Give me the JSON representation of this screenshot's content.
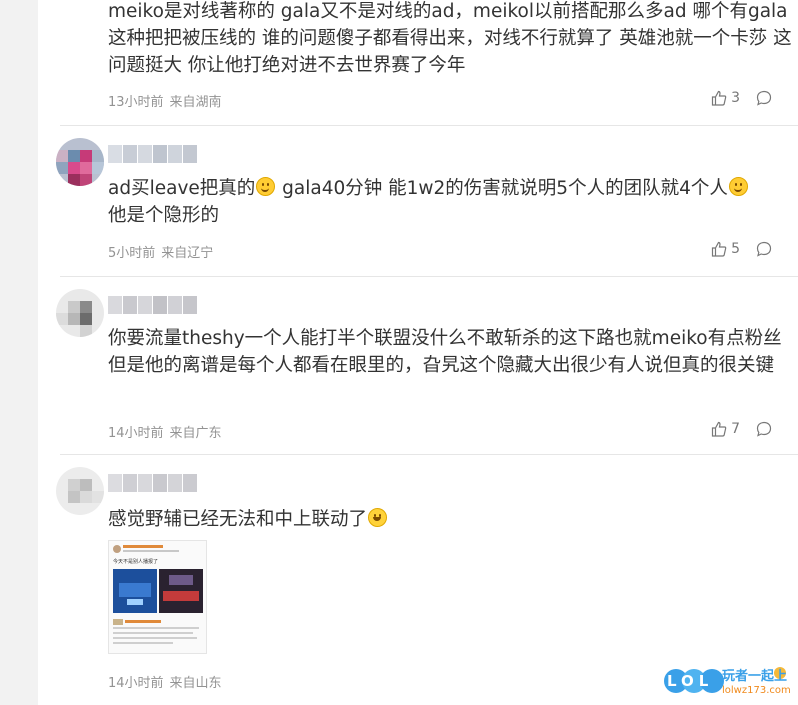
{
  "comments": [
    {
      "text": "meiko是对线著称的 gala又不是对线的ad，meikol以前搭配那么多ad 哪个有gala这种把把被压线的 谁的问题傻子都看得出来，对线不行就算了 英雄池就一个卡莎 这问题挺大 你让他打绝对进不去世界赛了今年",
      "time": "13小时前",
      "location": "来自湖南",
      "likes": "3"
    },
    {
      "text_parts": [
        "ad买leave把真的",
        " gala40分钟 能1w2的伤害就说明5个人的团队就4个人",
        "他是个隐形的"
      ],
      "time": "5小时前",
      "location": "来自辽宁",
      "likes": "5"
    },
    {
      "text": "你要流量theshy一个人能打半个联盟没什么不敢斩杀的这下路也就meiko有点粉丝但是他的离谱是每个人都看在眼里的，旮旯这个隐藏大出很少有人说但真的很关键",
      "time": "14小时前",
      "location": "来自广东",
      "likes": "7"
    },
    {
      "text": "感觉野辅已经无法和中上联动了",
      "time": "14小时前",
      "location": "来自山东",
      "image_caption": "今天不是别人播报了"
    }
  ],
  "watermark": {
    "brand": "LOL",
    "slogan": "玩者一起上",
    "site": "lolwz173.com"
  },
  "colors": {
    "text": "#333333",
    "meta": "#939393",
    "divider": "#e6e6e6",
    "watermark_blue": "#3aa0e8",
    "watermark_orange": "#f08a1c"
  },
  "icons": [
    "thumb-up-icon",
    "reply-bubble-icon",
    "smile-emoji-icon",
    "laugh-cry-emoji-icon"
  ]
}
